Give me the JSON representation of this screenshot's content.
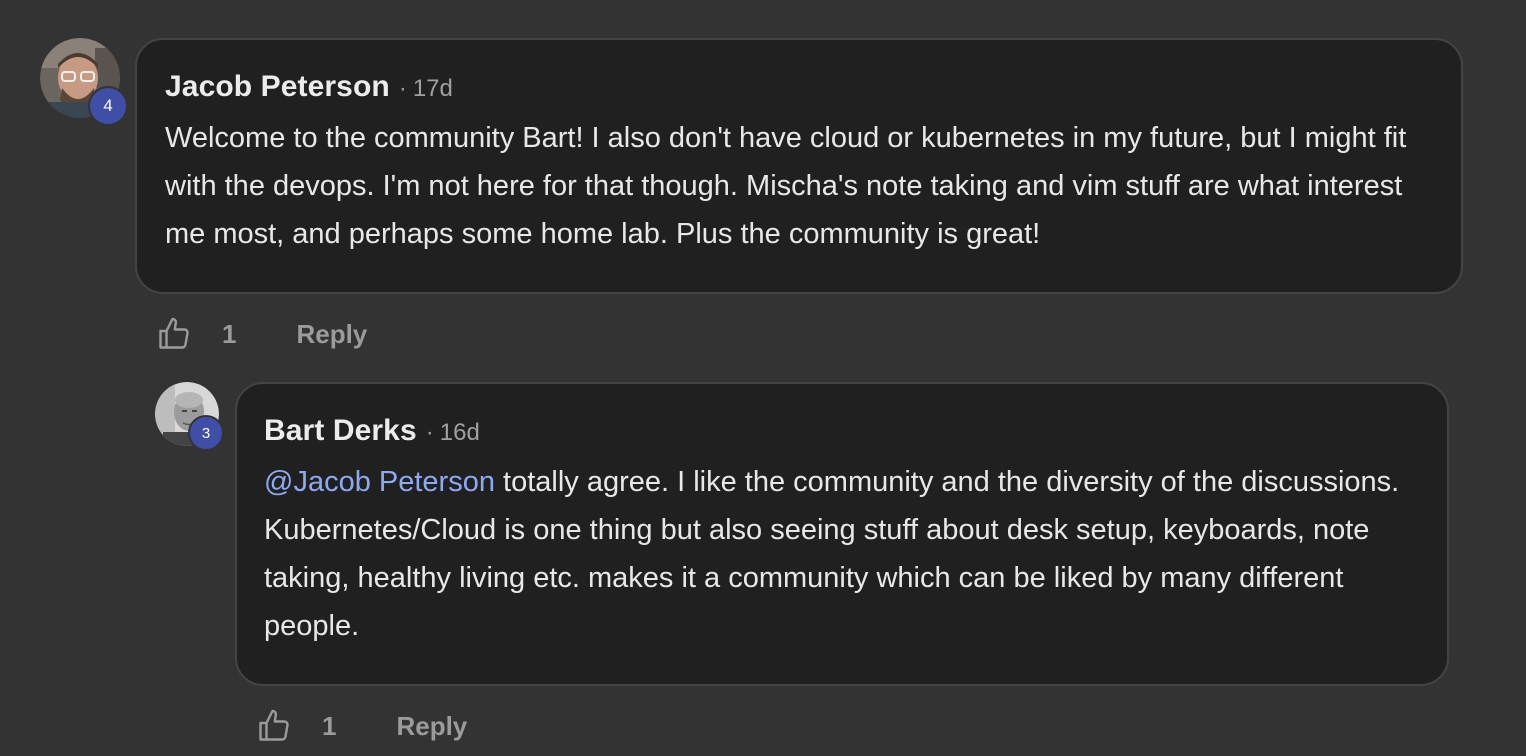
{
  "comments": [
    {
      "author": "Jacob Peterson",
      "separator": "·",
      "time": "17d",
      "level": "4",
      "body": "Welcome to the community Bart! I also don't have cloud or kubernetes in my future, but I might fit with the devops. I'm not here for that though. Mischa's note taking and vim stuff are what interest me most, and perhaps some home lab. Plus the community is great!",
      "likes": "1",
      "reply_label": "Reply"
    },
    {
      "author": "Bart Derks",
      "separator": "·",
      "time": "16d",
      "level": "3",
      "mention": "@Jacob Peterson",
      "body": " totally agree. I like the community and the diversity of the discussions. Kubernetes/Cloud is one thing but also seeing stuff about desk setup, keyboards, note taking, healthy living etc. makes it a community which can be liked by many different people.",
      "likes": "1",
      "reply_label": "Reply"
    }
  ],
  "icons": {
    "like": "thumbs-up-icon"
  },
  "colors": {
    "background": "#333333",
    "bubble": "#202020",
    "mention": "#8ea9f0",
    "level_badge": "#3f4fa8"
  }
}
